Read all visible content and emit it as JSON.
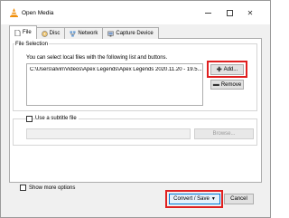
{
  "window": {
    "title": "Open Media"
  },
  "tabs": [
    {
      "label": "File"
    },
    {
      "label": "Disc"
    },
    {
      "label": "Network"
    },
    {
      "label": "Capture Device"
    }
  ],
  "file_selection": {
    "group_label": "File Selection",
    "hint": "You can select local files with the following list and buttons.",
    "files": [
      "C:\\Users\\alvin\\Videos\\Apex Legends\\Apex Legends 2020.11.20 - 19.5..."
    ],
    "add_label": "Add...",
    "remove_label": "Remove"
  },
  "subtitle": {
    "checkbox_label": "Use a subtitle file",
    "browse_label": "Browse..."
  },
  "footer": {
    "show_more_label": "Show more options",
    "convert_label": "Convert / Save",
    "cancel_label": "Cancel"
  },
  "colors": {
    "highlight": "#e02020",
    "accent": "#0078d7",
    "vlc_orange": "#f08a00"
  },
  "icons": {
    "app": "vlc-cone-icon",
    "file_tab": "file-icon",
    "disc_tab": "disc-icon",
    "network_tab": "network-icon",
    "capture_tab": "capture-device-icon",
    "add": "plus-icon",
    "remove": "minus-icon"
  }
}
